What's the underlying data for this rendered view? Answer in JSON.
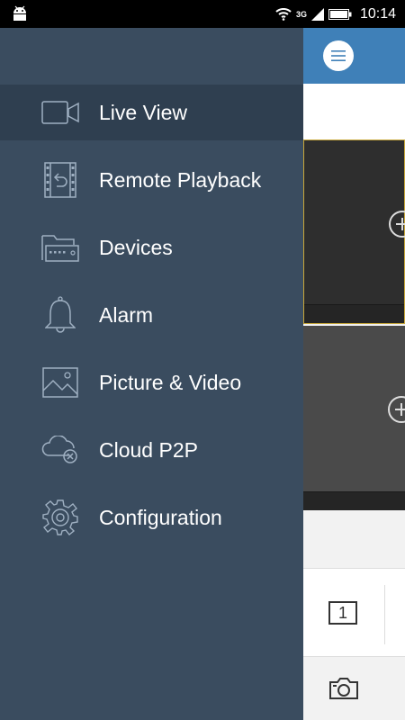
{
  "status_bar": {
    "network": "3G",
    "time": "10:14"
  },
  "drawer": {
    "items": [
      {
        "label": "Live View",
        "icon": "video-camera-icon",
        "active": true
      },
      {
        "label": "Remote Playback",
        "icon": "film-playback-icon",
        "active": false
      },
      {
        "label": "Devices",
        "icon": "devices-folder-icon",
        "active": false
      },
      {
        "label": "Alarm",
        "icon": "bell-icon",
        "active": false
      },
      {
        "label": "Picture & Video",
        "icon": "picture-icon",
        "active": false
      },
      {
        "label": "Cloud P2P",
        "icon": "cloud-icon",
        "active": false
      },
      {
        "label": "Configuration",
        "icon": "gear-icon",
        "active": false
      }
    ]
  },
  "main": {
    "split_label": "1"
  },
  "colors": {
    "drawer_bg": "#3a4c5f",
    "drawer_active": "#2f3f50",
    "header_blue": "#3f80b8",
    "selected_pane_border": "#c8a83a"
  }
}
